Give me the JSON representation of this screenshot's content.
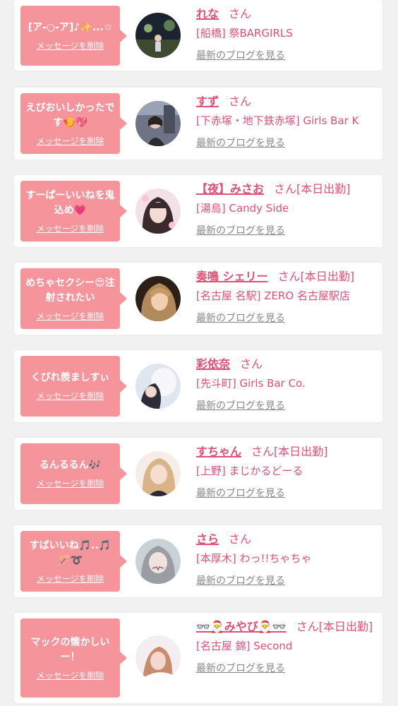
{
  "cards": [
    {
      "message": "[ア‐○‐ア]♪✨...☆",
      "name": "れな",
      "suffix": "さん",
      "badge": "",
      "shop": "[船橋] 祭BARGIRLS",
      "avatar_icon": "photo-night-street"
    },
    {
      "message": "えびおいしかったです🍤💖",
      "name": "すず",
      "suffix": "さん",
      "badge": "",
      "shop": "[下赤塚・地下鉄赤塚] Girls Bar K",
      "avatar_icon": "photo-street"
    },
    {
      "message": "すーぱーいいねを鬼込め💗",
      "name": "【夜】みさお",
      "suffix": "さん",
      "badge": "[本日出勤]",
      "shop": "[湯島] Candy Side",
      "avatar_icon": "photo-portrait-pink"
    },
    {
      "message": "めちゃセクシー😍注射されたい",
      "name": "奏鳴 シェリー",
      "suffix": "さん",
      "badge": "[本日出勤]",
      "shop": "[名古屋 名駅] ZERO 名古屋駅店",
      "avatar_icon": "photo-portrait-warm"
    },
    {
      "message": "くびれ羨ましすぃ",
      "name": "彩依奈",
      "suffix": "さん",
      "badge": "",
      "shop": "[先斗町] Girls Bar Co.",
      "avatar_icon": "photo-portrait-veil"
    },
    {
      "message": "るんるるん🎶",
      "name": "すちゃん",
      "suffix": "さん",
      "badge": "[本日出勤]",
      "shop": "[上野] まじかるどーる",
      "avatar_icon": "photo-portrait-blonde"
    },
    {
      "message": "すばいいね🎵..🎵🪄➰",
      "name": "さら",
      "suffix": "さん",
      "badge": "",
      "shop": "[本厚木] わっ!!ちゃちゃ",
      "avatar_icon": "photo-portrait-filter"
    },
    {
      "message": "マックの懐かしいー！",
      "name": "👓🎅みやび🎅👓",
      "suffix": "さん",
      "badge": "[本日出勤]",
      "shop": "[名古屋 錦] Second",
      "avatar_icon": "photo-portrait-bed"
    }
  ],
  "delete_label": "メッセージを削除",
  "blog_label": "最新のブログを見る",
  "colors": {
    "bubble": "#f6949c",
    "accent": "#e24f74",
    "link_gray": "#888888",
    "background": "#f1f1f1"
  }
}
